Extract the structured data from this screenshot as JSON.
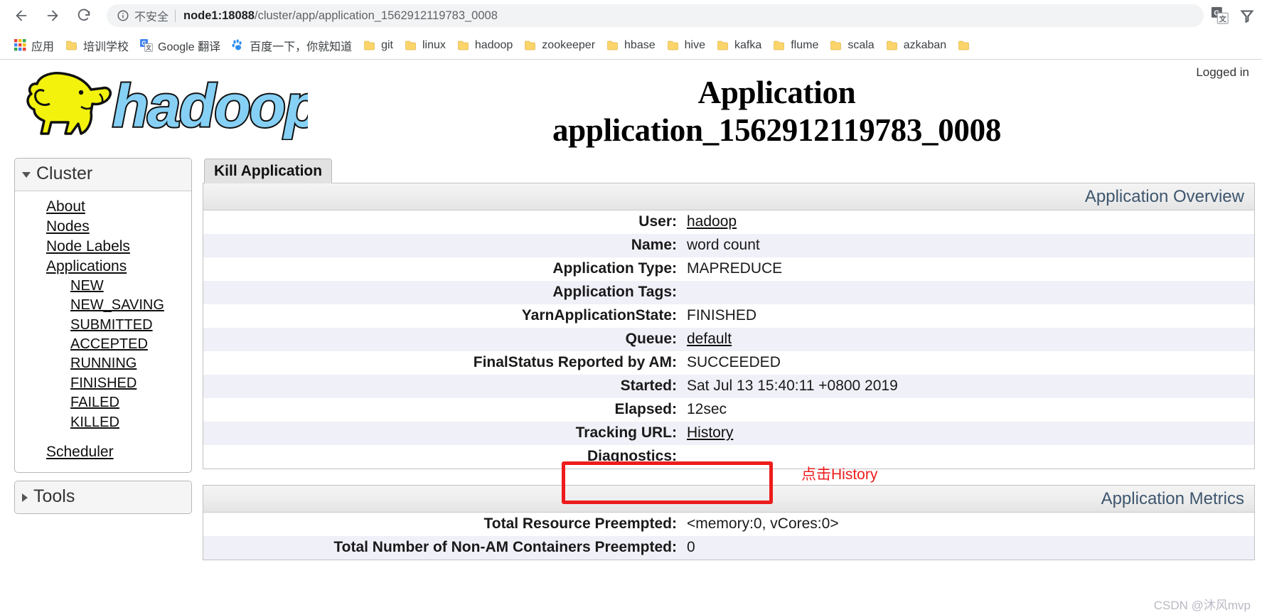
{
  "browser": {
    "back_label": "back-arrow",
    "forward_label": "forward-arrow",
    "reload_label": "reload",
    "security_text": "不安全",
    "url_host": "node1:18088",
    "url_path": "/cluster/app/application_1562912119783_0008",
    "url_full": "node1:18088/cluster/app/application_1562912119783_0008",
    "translate_icon": "google-translate-icon",
    "menu_icon": "browser-menu-icon"
  },
  "bookmarks": [
    {
      "label": "应用",
      "icon": "apps-grid-icon"
    },
    {
      "label": "培训学校",
      "icon": "folder-icon"
    },
    {
      "label": "Google 翻译",
      "icon": "google-translate-icon"
    },
    {
      "label": "百度一下，你就知道",
      "icon": "baidu-icon"
    },
    {
      "label": "git",
      "icon": "folder-icon"
    },
    {
      "label": "linux",
      "icon": "folder-icon"
    },
    {
      "label": "hadoop",
      "icon": "folder-icon"
    },
    {
      "label": "zookeeper",
      "icon": "folder-icon"
    },
    {
      "label": "hbase",
      "icon": "folder-icon"
    },
    {
      "label": "hive",
      "icon": "folder-icon"
    },
    {
      "label": "kafka",
      "icon": "folder-icon"
    },
    {
      "label": "flume",
      "icon": "folder-icon"
    },
    {
      "label": "scala",
      "icon": "folder-icon"
    },
    {
      "label": "azkaban",
      "icon": "folder-icon"
    },
    {
      "label": "",
      "icon": "folder-icon"
    }
  ],
  "header": {
    "logo_text": "hadoop",
    "title_line1": "Application",
    "title_line2": "application_1562912119783_0008",
    "logged_in": "Logged in"
  },
  "sidebar": {
    "cluster": {
      "title": "Cluster",
      "expanded": true,
      "links": [
        {
          "label": "About",
          "level": 1
        },
        {
          "label": "Nodes",
          "level": 1
        },
        {
          "label": "Node Labels",
          "level": 1
        },
        {
          "label": "Applications",
          "level": 1
        },
        {
          "label": "NEW",
          "level": 2
        },
        {
          "label": "NEW_SAVING",
          "level": 2
        },
        {
          "label": "SUBMITTED",
          "level": 2
        },
        {
          "label": "ACCEPTED",
          "level": 2
        },
        {
          "label": "RUNNING",
          "level": 2
        },
        {
          "label": "FINISHED",
          "level": 2
        },
        {
          "label": "FAILED",
          "level": 2
        },
        {
          "label": "KILLED",
          "level": 2
        },
        {
          "label": "Scheduler",
          "level": 1,
          "gap_before": true
        }
      ]
    },
    "tools": {
      "title": "Tools",
      "expanded": false
    }
  },
  "main": {
    "kill_application_tab": "Kill Application",
    "overview": {
      "caption": "Application Overview",
      "rows": [
        {
          "key": "User:",
          "value": "hadoop",
          "link": true
        },
        {
          "key": "Name:",
          "value": "word count",
          "link": false
        },
        {
          "key": "Application Type:",
          "value": "MAPREDUCE",
          "link": false
        },
        {
          "key": "Application Tags:",
          "value": "",
          "link": false
        },
        {
          "key": "YarnApplicationState:",
          "value": "FINISHED",
          "link": false
        },
        {
          "key": "Queue:",
          "value": "default",
          "link": true
        },
        {
          "key": "FinalStatus Reported by AM:",
          "value": "SUCCEEDED",
          "link": false
        },
        {
          "key": "Started:",
          "value": "Sat Jul 13 15:40:11 +0800 2019",
          "link": false
        },
        {
          "key": "Elapsed:",
          "value": "12sec",
          "link": false
        },
        {
          "key": "Tracking URL:",
          "value": "History",
          "link": true
        },
        {
          "key": "Diagnostics:",
          "value": "",
          "link": false
        }
      ]
    },
    "metrics": {
      "caption": "Application Metrics",
      "rows": [
        {
          "key": "Total Resource Preempted:",
          "value": "<memory:0, vCores:0>",
          "link": false
        },
        {
          "key": "Total Number of Non-AM Containers Preempted:",
          "value": "0",
          "link": false
        }
      ]
    }
  },
  "annotations": {
    "red_note": "点击History",
    "red_color": "#ee1c1c",
    "watermark": "CSDN @沐风mvp"
  }
}
